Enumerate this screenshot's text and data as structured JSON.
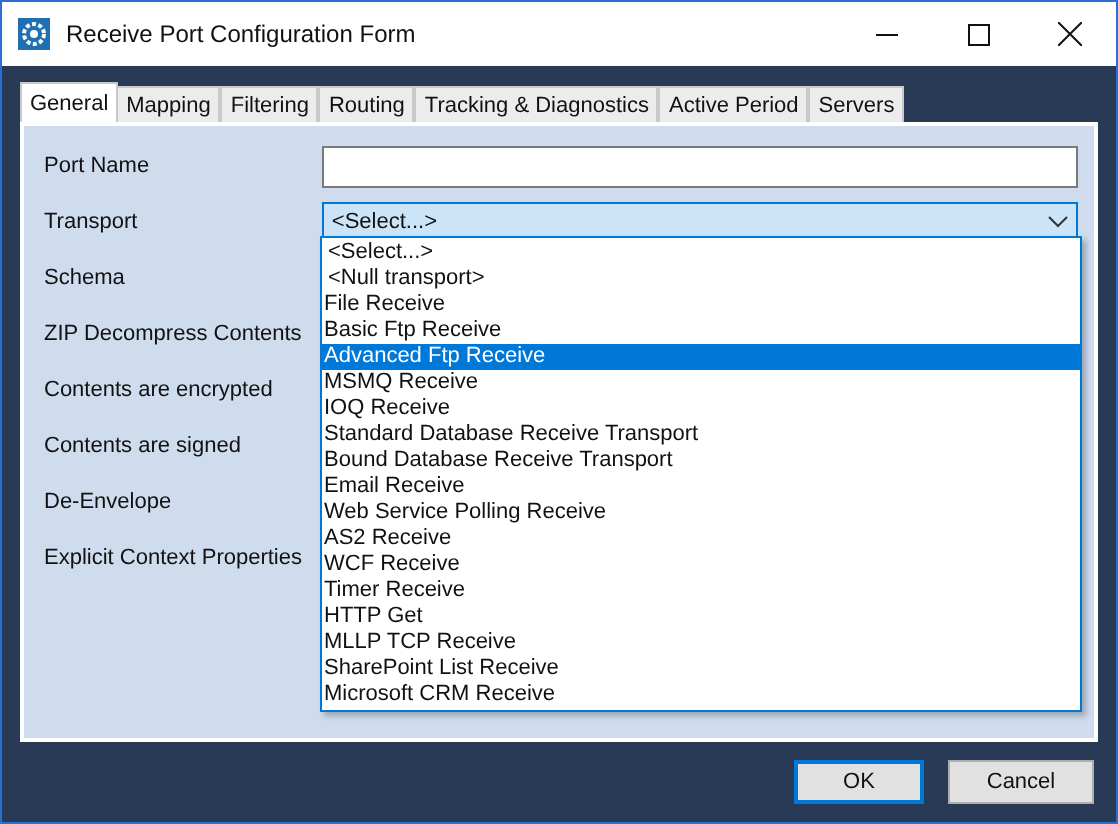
{
  "window": {
    "title": "Receive Port Configuration Form"
  },
  "tabs": [
    {
      "label": "General",
      "selected": true
    },
    {
      "label": "Mapping",
      "selected": false
    },
    {
      "label": "Filtering",
      "selected": false
    },
    {
      "label": "Routing",
      "selected": false
    },
    {
      "label": "Tracking & Diagnostics",
      "selected": false
    },
    {
      "label": "Active Period",
      "selected": false
    },
    {
      "label": "Servers",
      "selected": false
    }
  ],
  "fields": [
    {
      "label": "Port Name",
      "kind": "text"
    },
    {
      "label": "Transport",
      "kind": "select",
      "value": "<Select...>",
      "expanded": true
    },
    {
      "label": "Schema",
      "kind": "none"
    },
    {
      "label": "ZIP Decompress Contents",
      "kind": "none"
    },
    {
      "label": "Contents are encrypted",
      "kind": "none"
    },
    {
      "label": "Contents are signed",
      "kind": "none"
    },
    {
      "label": "De-Envelope",
      "kind": "none"
    },
    {
      "label": "Explicit Context Properties",
      "kind": "none"
    }
  ],
  "dropdown_options": [
    {
      "label": "<Select...>",
      "selected": false
    },
    {
      "label": "<Null transport>",
      "selected": false
    },
    {
      "label": "File Receive",
      "selected": false
    },
    {
      "label": "Basic Ftp Receive",
      "selected": false
    },
    {
      "label": "Advanced Ftp Receive",
      "selected": true
    },
    {
      "label": "MSMQ Receive",
      "selected": false
    },
    {
      "label": "IOQ Receive",
      "selected": false
    },
    {
      "label": "Standard Database Receive Transport",
      "selected": false
    },
    {
      "label": "Bound Database Receive Transport",
      "selected": false
    },
    {
      "label": "Email Receive",
      "selected": false
    },
    {
      "label": "Web Service Polling Receive",
      "selected": false
    },
    {
      "label": "AS2 Receive",
      "selected": false
    },
    {
      "label": "WCF Receive",
      "selected": false
    },
    {
      "label": "Timer Receive",
      "selected": false
    },
    {
      "label": "HTTP Get",
      "selected": false
    },
    {
      "label": "MLLP TCP Receive",
      "selected": false
    },
    {
      "label": "SharePoint List Receive",
      "selected": false
    },
    {
      "label": "Microsoft CRM Receive",
      "selected": false
    }
  ],
  "buttons": [
    {
      "label": "OK",
      "default": true
    },
    {
      "label": "Cancel",
      "default": false
    }
  ]
}
